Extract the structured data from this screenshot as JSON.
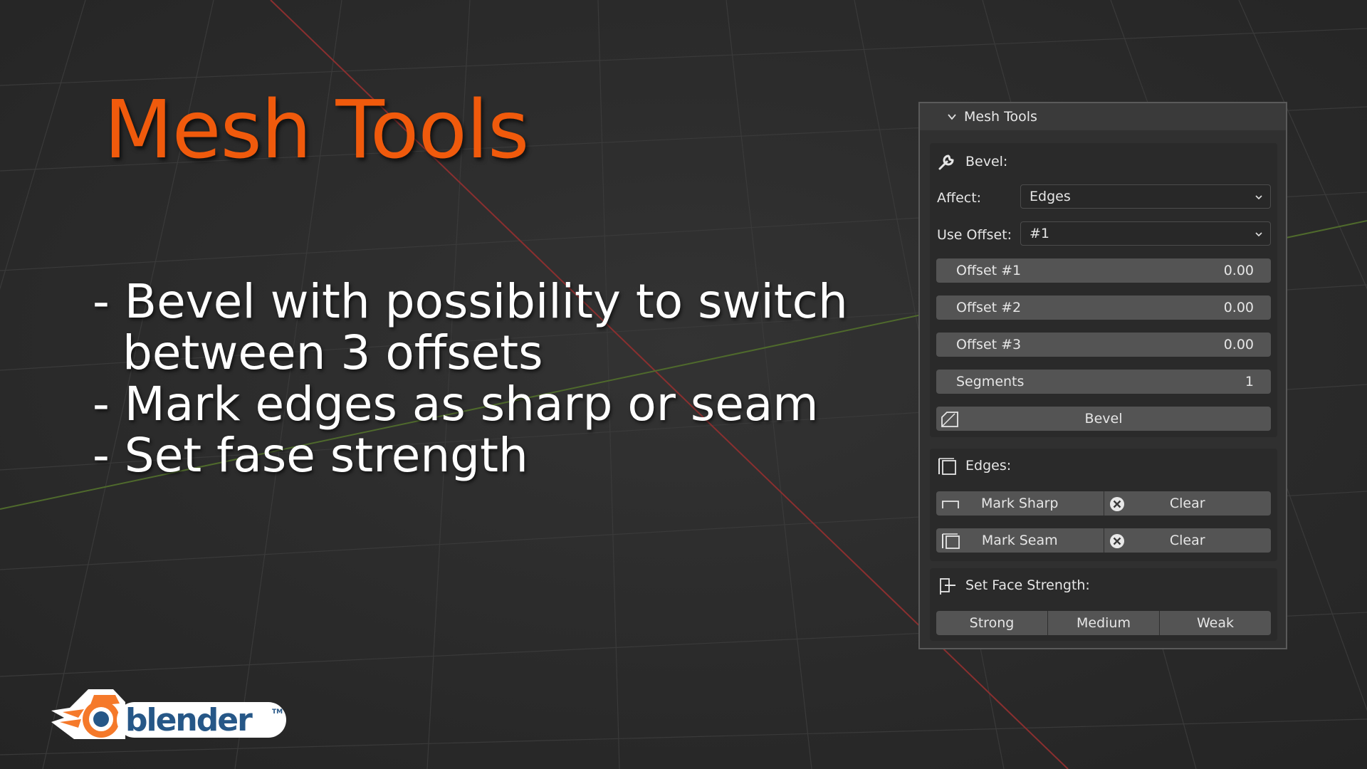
{
  "slide": {
    "title": "Mesh Tools",
    "bullets": [
      "- Bevel with possibility to switch",
      "between 3 offsets",
      "- Mark edges as sharp or seam",
      "- Set fase strength"
    ]
  },
  "panel": {
    "header": "Mesh Tools",
    "bevel": {
      "section_label": "Bevel:",
      "affect_label": "Affect:",
      "affect_value": "Edges",
      "use_offset_label": "Use Offset:",
      "use_offset_value": "#1",
      "offsets": [
        {
          "label": "Offset #1",
          "value": "0.00"
        },
        {
          "label": "Offset #2",
          "value": "0.00"
        },
        {
          "label": "Offset #3",
          "value": "0.00"
        }
      ],
      "segments_label": "Segments",
      "segments_value": "1",
      "bevel_button": "Bevel"
    },
    "edges": {
      "section_label": "Edges:",
      "mark_sharp": "Mark Sharp",
      "clear_sharp": "Clear",
      "mark_seam": "Mark Seam",
      "clear_seam": "Clear"
    },
    "face_strength": {
      "section_label": "Set Face Strength:",
      "options": [
        "Strong",
        "Medium",
        "Weak"
      ]
    }
  },
  "logo": {
    "text": "blender",
    "trademark": "TM"
  },
  "colors": {
    "accent": "#f05a0c",
    "background": "#2b2b2b",
    "panel_bg": "#303030",
    "button_bg": "#545454",
    "logo_blue": "#265787"
  },
  "icons": [
    "chevron-down-icon",
    "wrench-icon",
    "dropdown-arrow-icon",
    "bevel-icon",
    "edges-icon",
    "sharp-edge-icon",
    "seam-icon",
    "clear-x-icon",
    "face-strength-icon",
    "blender-logo"
  ]
}
